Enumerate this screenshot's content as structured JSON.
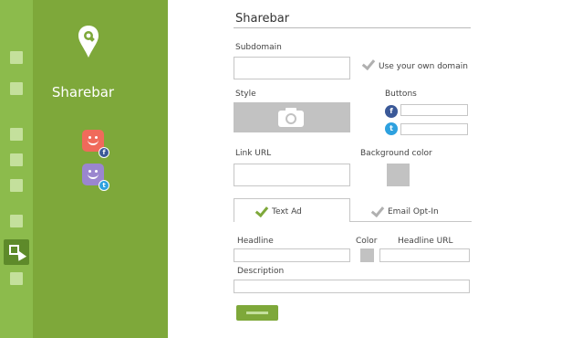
{
  "app": {
    "brand": "Sharebar"
  },
  "rail": {
    "items": [
      "square-icon",
      "square-icon",
      "square-icon",
      "square-icon",
      "square-icon",
      "square-icon",
      "cursor-window-icon",
      "square-icon"
    ],
    "active": "cursor-window-icon"
  },
  "preview": {
    "avatars": [
      {
        "network": "facebook",
        "badge": "f"
      },
      {
        "network": "twitter",
        "badge": "t"
      }
    ]
  },
  "form": {
    "title": "Sharebar",
    "subdomain": {
      "label": "Subdomain",
      "value": "",
      "own_domain_label": "Use your own domain"
    },
    "style": {
      "label": "Style",
      "icon": "camera-icon"
    },
    "buttons": {
      "label": "Buttons",
      "facebook_value": "",
      "twitter_value": "",
      "facebook_glyph": "f",
      "twitter_glyph": "t"
    },
    "link_url": {
      "label": "Link URL",
      "value": ""
    },
    "background_color": {
      "label": "Background color",
      "value": "#c2c2c2"
    },
    "tabs": [
      {
        "label": "Text Ad",
        "active": true
      },
      {
        "label": "Email Opt-In",
        "active": false
      }
    ],
    "headline": {
      "label": "Headline",
      "value": ""
    },
    "color": {
      "label": "Color",
      "value": "#c2c2c2"
    },
    "headline_url": {
      "label": "Headline URL",
      "value": ""
    },
    "description": {
      "label": "Description",
      "value": ""
    },
    "save_button": {
      "label": ""
    }
  },
  "colors": {
    "accent": "#7ea83a",
    "rail": "#8cbb4c",
    "rail_active": "#5e8a2a",
    "facebook": "#3b5998",
    "twitter": "#2ea1df"
  }
}
